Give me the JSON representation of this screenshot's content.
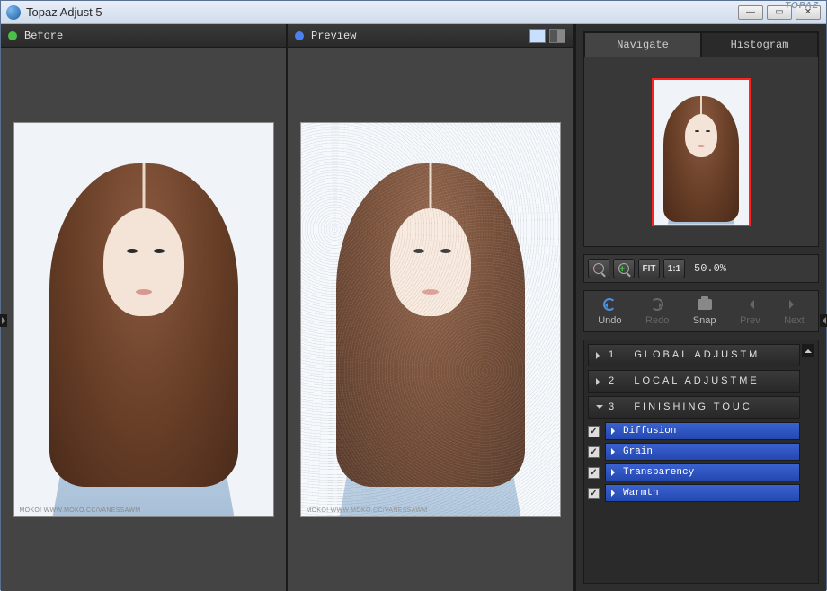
{
  "app_title": "Topaz Adjust 5",
  "brand": "TOPAZ",
  "panes": {
    "before": "Before",
    "preview": "Preview"
  },
  "watermark": "MOKO! WWW.MOKO.CC/VANESSAWM",
  "nav_tabs": {
    "navigate": "Navigate",
    "histogram": "Histogram"
  },
  "zoom": {
    "fit": "FIT",
    "one": "1:1",
    "level": "50.0%"
  },
  "actions": {
    "undo": "Undo",
    "redo": "Redo",
    "snap": "Snap",
    "prev": "Prev",
    "next": "Next"
  },
  "sections": [
    {
      "num": "1",
      "label": "GLOBAL ADJUSTM"
    },
    {
      "num": "2",
      "label": "LOCAL ADJUSTME"
    },
    {
      "num": "3",
      "label": "FINISHING TOUC"
    }
  ],
  "subitems": [
    {
      "label": "Diffusion",
      "checked": true
    },
    {
      "label": "Grain",
      "checked": true
    },
    {
      "label": "Transparency",
      "checked": true
    },
    {
      "label": "Warmth",
      "checked": true
    }
  ]
}
